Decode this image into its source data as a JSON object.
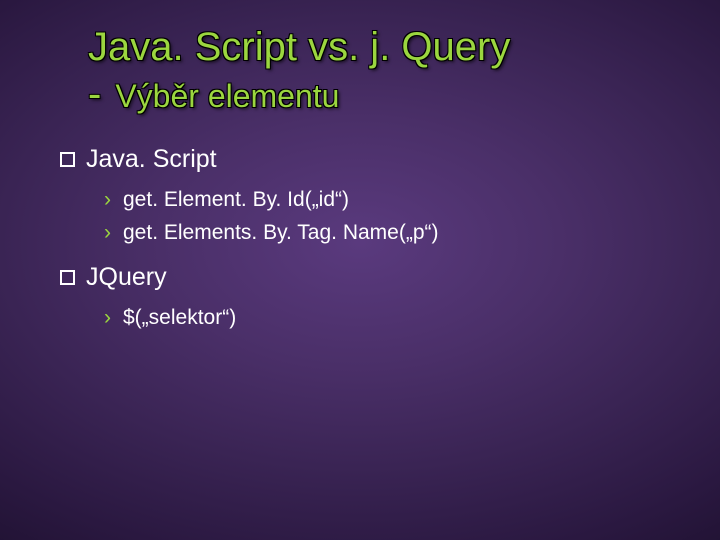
{
  "title": "Java. Script vs. j. Query",
  "dash": "-",
  "subtitle": "Výběr elementu",
  "sections": [
    {
      "heading": "Java. Script",
      "items": [
        "get. Element. By. Id(„id“)",
        "get. Elements. By. Tag. Name(„p“)"
      ]
    },
    {
      "heading": "JQuery",
      "items": [
        "$(„selektor“)"
      ]
    }
  ]
}
